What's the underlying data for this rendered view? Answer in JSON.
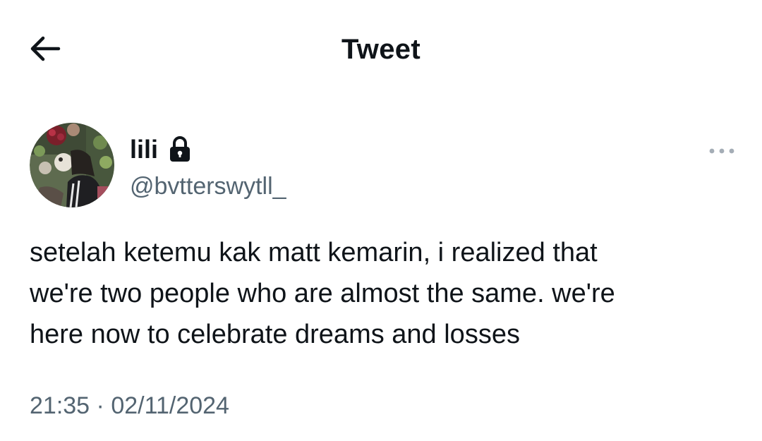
{
  "header": {
    "back_icon": "arrow-left-icon",
    "title": "Tweet"
  },
  "author": {
    "display_name": "lili",
    "protected_icon": "lock-icon",
    "handle": "@bvtterswytll_",
    "avatar": "profile-photo"
  },
  "more_icon": "more-horizontal-icon",
  "tweet": {
    "lines": [
      "setelah ketemu kak matt kemarin, i realized that",
      "we're two people who are almost the same. we're",
      "here now to celebrate dreams and losses"
    ]
  },
  "meta": {
    "time": "21:35",
    "separator": "·",
    "date": "02/11/2024"
  },
  "colors": {
    "text": "#0f1419",
    "secondary": "#536471",
    "background": "#ffffff"
  }
}
